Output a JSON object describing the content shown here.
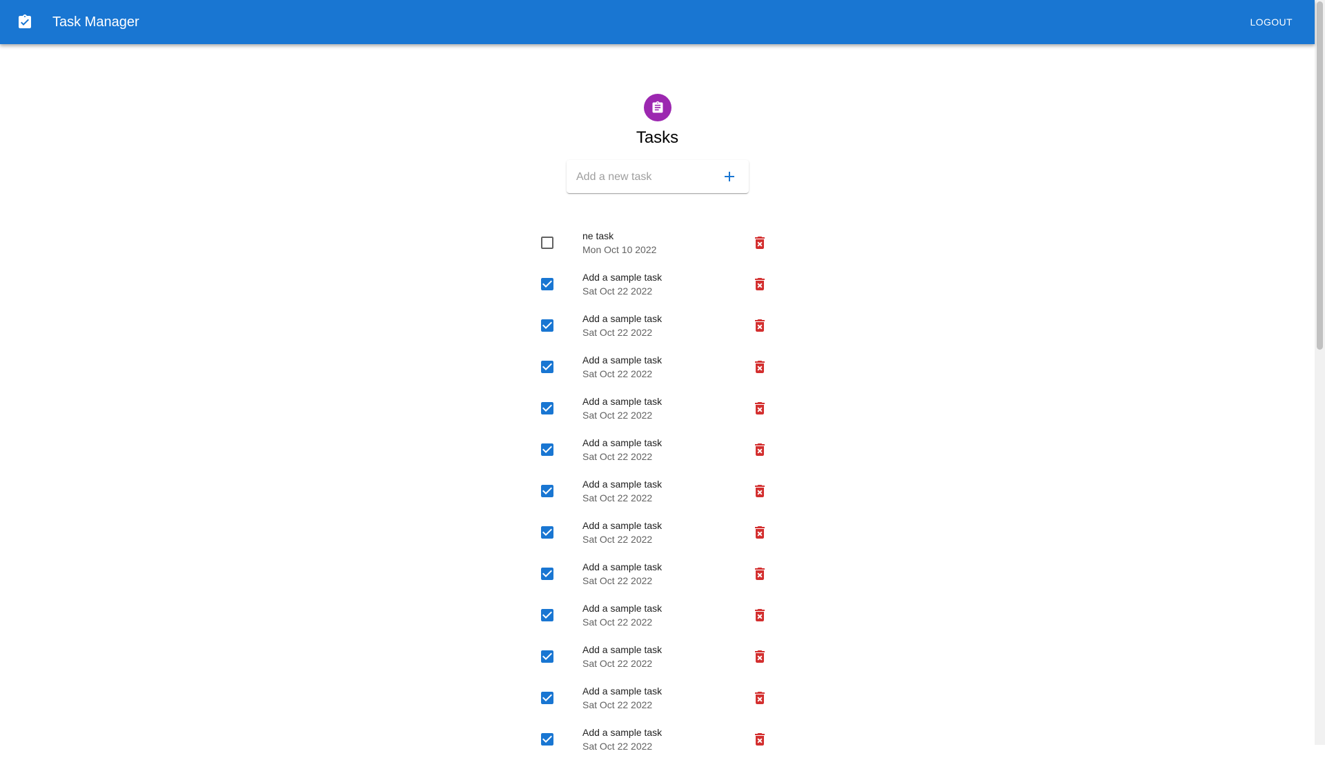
{
  "app": {
    "title": "Task Manager",
    "logout_label": "LOGOUT",
    "brand_color": "#1976d2",
    "logo_icon": "assignment-turned-in-icon"
  },
  "page": {
    "avatar_icon": "assignment-icon",
    "avatar_color": "#9c27b0",
    "title": "Tasks"
  },
  "add_task": {
    "placeholder": "Add a new task",
    "value": "",
    "button_icon": "plus-icon"
  },
  "tasks": [
    {
      "title": "ne task",
      "date": "Mon Oct 10 2022",
      "completed": false
    },
    {
      "title": "Add a sample task",
      "date": "Sat Oct 22 2022",
      "completed": true
    },
    {
      "title": "Add a sample task",
      "date": "Sat Oct 22 2022",
      "completed": true
    },
    {
      "title": "Add a sample task",
      "date": "Sat Oct 22 2022",
      "completed": true
    },
    {
      "title": "Add a sample task",
      "date": "Sat Oct 22 2022",
      "completed": true
    },
    {
      "title": "Add a sample task",
      "date": "Sat Oct 22 2022",
      "completed": true
    },
    {
      "title": "Add a sample task",
      "date": "Sat Oct 22 2022",
      "completed": true
    },
    {
      "title": "Add a sample task",
      "date": "Sat Oct 22 2022",
      "completed": true
    },
    {
      "title": "Add a sample task",
      "date": "Sat Oct 22 2022",
      "completed": true
    },
    {
      "title": "Add a sample task",
      "date": "Sat Oct 22 2022",
      "completed": true
    },
    {
      "title": "Add a sample task",
      "date": "Sat Oct 22 2022",
      "completed": true
    },
    {
      "title": "Add a sample task",
      "date": "Sat Oct 22 2022",
      "completed": true
    },
    {
      "title": "Add a sample task",
      "date": "Sat Oct 22 2022",
      "completed": true
    }
  ],
  "colors": {
    "checkbox_checked": "#1976d2",
    "checkbox_unchecked": "#616161",
    "delete": "#d32f2f"
  }
}
